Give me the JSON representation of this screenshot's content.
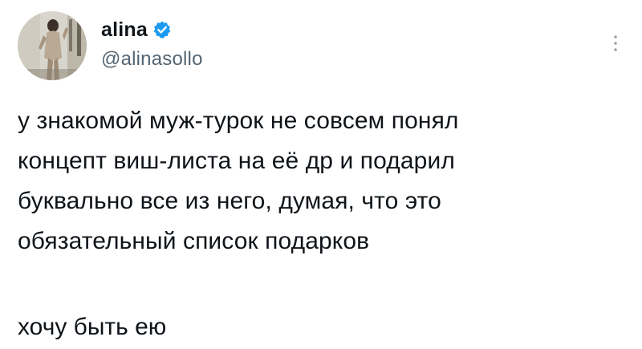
{
  "tweet": {
    "author": {
      "display_name": "alina",
      "handle": "@alinasollo",
      "verified": true,
      "avatar_icon": "profile-photo"
    },
    "more_icon": "vertical-ellipsis-icon",
    "text_lines": [
      "у знакомой муж-турок не совсем понял",
      "концепт виш-листа на её др и подарил",
      "буквально все из него, думая, что это",
      "обязательный список подарков"
    ],
    "closing_line": "хочу быть ею"
  },
  "colors": {
    "text": "#0f1419",
    "secondary": "#536471",
    "verified": "#1d9bf0",
    "background": "#ffffff"
  }
}
